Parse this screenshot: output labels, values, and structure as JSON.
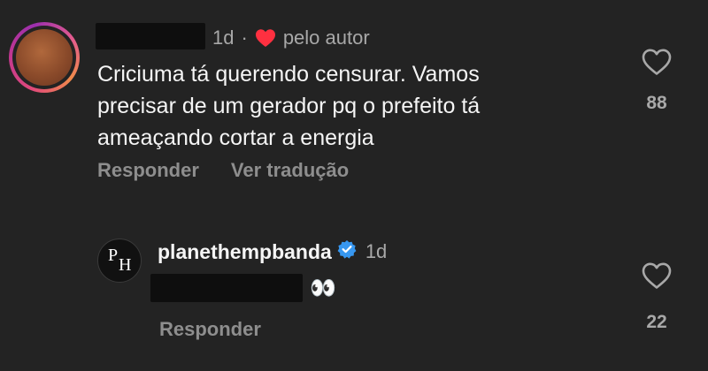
{
  "comment": {
    "time": "1d",
    "separator": "·",
    "liked_by_author": "pelo autor",
    "text": "Criciuma tá querendo censurar. Vamos\nprecisar de um gerador pq o prefeito tá\nameaçando cortar a energia",
    "reply_label": "Responder",
    "translate_label": "Ver tradução",
    "like_count": "88"
  },
  "reply": {
    "avatar_initial_1": "P",
    "avatar_initial_2": "H",
    "username": "planethempbanda",
    "time": "1d",
    "emoji": "👀",
    "reply_label": "Responder",
    "like_count": "22"
  },
  "colors": {
    "background": "#232323",
    "heart_red": "#ff3040",
    "verified_blue": "#3797f0",
    "muted": "#a8a8a8"
  }
}
